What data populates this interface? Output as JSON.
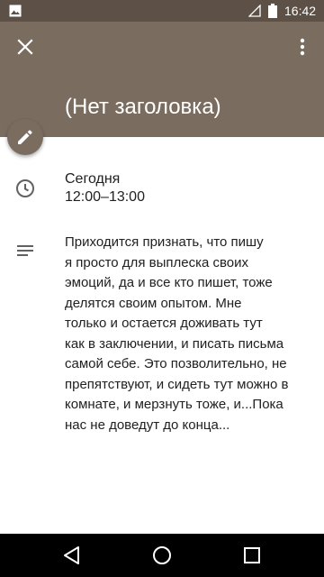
{
  "status_bar": {
    "time": "16:42",
    "icons": [
      "gallery-icon",
      "signal-icon",
      "battery-icon"
    ]
  },
  "header": {
    "title": "(Нет заголовка)",
    "close_icon": "close-icon",
    "more_icon": "more-vert-icon",
    "color": "#7b6c60"
  },
  "fab": {
    "icon": "edit-icon"
  },
  "event": {
    "date": "Сегодня",
    "time_range": "12:00–13:00",
    "description": "Приходится признать, что пишу\nя просто для выплеска своих\nэмоций, да и все кто пишет, тоже\nделятся своим опытом. Мне\nтолько и остается доживать тут\nкак в заключении, и писать письма\nсамой себе. Это позволительно, не\nпрепятствуют, и сидеть тут можно в\nкомнате, и мерзнуть тоже, и...Пока\nнас не доведут до конца..."
  },
  "nav_bar": {
    "icons": [
      "back-icon",
      "home-icon",
      "recents-icon"
    ]
  }
}
